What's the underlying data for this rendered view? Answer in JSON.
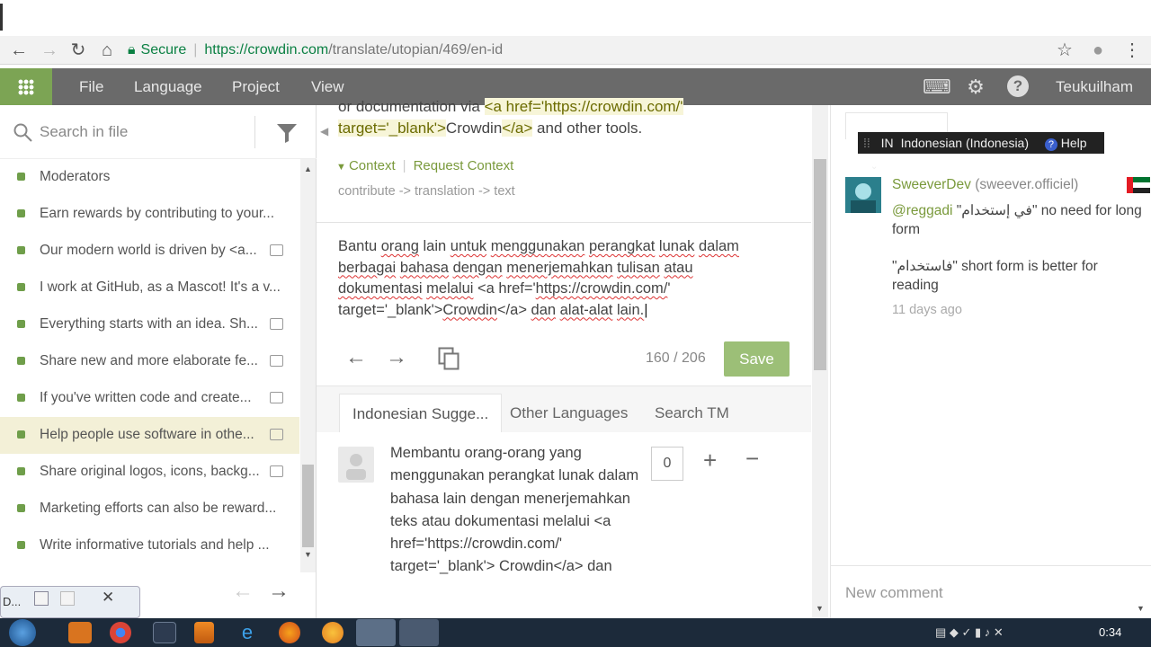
{
  "browser": {
    "secure_label": "Secure",
    "url_host": "https://crowdin.com",
    "url_path": "/translate/utopian/469/en-id"
  },
  "appbar": {
    "menus": [
      "File",
      "Language",
      "Project",
      "View"
    ],
    "username": "Teukuilham"
  },
  "sidebar": {
    "search_placeholder": "Search in file",
    "files": [
      {
        "label": "Moderators",
        "comment": false,
        "active": false
      },
      {
        "label": "Earn rewards by contributing to your...",
        "comment": false,
        "active": false
      },
      {
        "label": "Our modern world is driven by <a...",
        "comment": true,
        "active": false
      },
      {
        "label": "I work at GitHub, as a Mascot! It's a v...",
        "comment": false,
        "active": false
      },
      {
        "label": "Everything starts with an idea. Sh...",
        "comment": true,
        "active": false
      },
      {
        "label": "Share new and more elaborate fe...",
        "comment": true,
        "active": false
      },
      {
        "label": "If you've written code and create...",
        "comment": true,
        "active": false
      },
      {
        "label": "Help people use software in othe...",
        "comment": true,
        "active": true
      },
      {
        "label": "Share original logos, icons, backg...",
        "comment": true,
        "active": false
      },
      {
        "label": "Marketing efforts can also be reward...",
        "comment": false,
        "active": false
      },
      {
        "label": "Write informative tutorials and help ...",
        "comment": false,
        "active": false
      }
    ]
  },
  "editor": {
    "source_line1_pre": "or documentation via ",
    "source_line1_code": "<a href='https://crowdin.com/'",
    "source_line2_code": "target='_blank'>",
    "source_line2_word": "Crowdin",
    "source_line2_code2": "</a>",
    "source_line2_post": " and other tools.",
    "context_label": "Context",
    "request_context": "Request Context",
    "context_path": "contribute -> translation -> text",
    "translation_words": [
      [
        "Bantu ",
        false
      ],
      [
        "orang",
        true
      ],
      [
        " lain ",
        false
      ],
      [
        "untuk",
        true
      ],
      [
        " ",
        false
      ],
      [
        "menggunakan",
        true
      ],
      [
        " ",
        false
      ],
      [
        "perangkat",
        true
      ],
      [
        " ",
        false
      ],
      [
        "lunak",
        true
      ],
      [
        " ",
        false
      ],
      [
        "dalam",
        true
      ],
      [
        " ",
        false
      ],
      [
        "berbagai",
        true
      ],
      [
        " ",
        false
      ],
      [
        "bahasa",
        true
      ],
      [
        " ",
        false
      ],
      [
        "dengan",
        true
      ],
      [
        " ",
        false
      ],
      [
        "menerjemahkan",
        true
      ],
      [
        " ",
        false
      ],
      [
        "tulisan",
        true
      ],
      [
        " ",
        false
      ],
      [
        "atau",
        true
      ],
      [
        " ",
        false
      ],
      [
        "dokumentasi",
        true
      ],
      [
        " ",
        false
      ],
      [
        "melalui",
        true
      ],
      [
        "  <a href='",
        false
      ],
      [
        "https://crowdin.com/",
        true
      ],
      [
        "' target='_blank'>",
        false
      ],
      [
        "Crowdin",
        true
      ],
      [
        "</a> ",
        false
      ],
      [
        "dan",
        true
      ],
      [
        " ",
        false
      ],
      [
        "alat-alat",
        true
      ],
      [
        " ",
        false
      ],
      [
        "lain.",
        true
      ]
    ],
    "counter": "160 / 206",
    "save_label": "Save"
  },
  "suggestions": {
    "tabs": [
      "Indonesian Sugge...",
      "Other Languages",
      "Search TM"
    ],
    "active_tab": 0,
    "text": "Membantu orang-orang yang menggunakan perangkat lunak dalam bahasa lain dengan menerjemahkan teks atau dokumentasi melalui <a href='https://crowdin.com/' target='_blank'> Crowdin</a> dan",
    "votes": "0"
  },
  "right_panel": {
    "lang_code": "IN",
    "lang_name": "Indonesian (Indonesia)",
    "help_label": "Help",
    "comment": {
      "user": "SweeverDev",
      "handle": "(sweever.officiel)",
      "mention": "@reggadi",
      "arabic1": "\"في إستخدام\"",
      "body1_rest": " no need for long form",
      "arabic2": "\"فاستخدام\"",
      "body2_rest": " short form is better for reading",
      "time": "11 days ago"
    },
    "new_comment_placeholder": "New comment"
  },
  "mini_window": {
    "label": "D..."
  },
  "taskbar": {
    "clock": "0:34"
  },
  "colors": {
    "accent_green": "#7ca454",
    "header_gray": "#6a6a6a",
    "save_button": "#9cbf77",
    "active_row": "#f3f0d7"
  }
}
